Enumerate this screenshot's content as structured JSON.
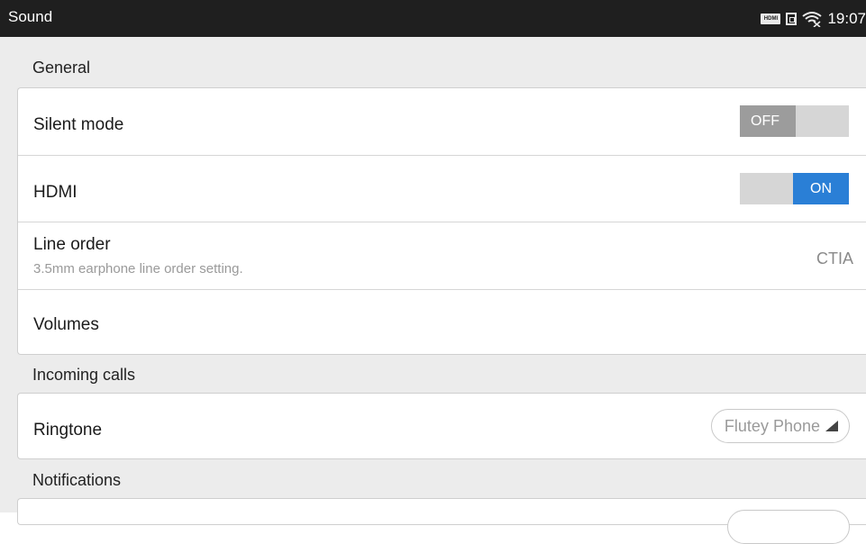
{
  "status_bar": {
    "title": "Sound",
    "time": "19:07",
    "hdmi_icon_text": "HDMI",
    "icons": [
      "hdmi-icon",
      "sim-icon",
      "wifi-icon"
    ]
  },
  "sections": {
    "general": {
      "header": "General",
      "silent_mode": {
        "label": "Silent mode",
        "state": "OFF"
      },
      "hdmi": {
        "label": "HDMI",
        "state": "ON"
      },
      "line_order": {
        "label": "Line order",
        "sub": "3.5mm earphone line order setting.",
        "value": "CTIA"
      },
      "volumes": {
        "label": "Volumes"
      }
    },
    "incoming_calls": {
      "header": "Incoming calls",
      "ringtone": {
        "label": "Ringtone",
        "value": "Flutey Phone"
      }
    },
    "notifications": {
      "header": "Notifications"
    }
  },
  "colors": {
    "on_accent": "#2a7fd6",
    "statusbar_bg": "#1f1f1f",
    "panel_bg": "#ececec"
  }
}
